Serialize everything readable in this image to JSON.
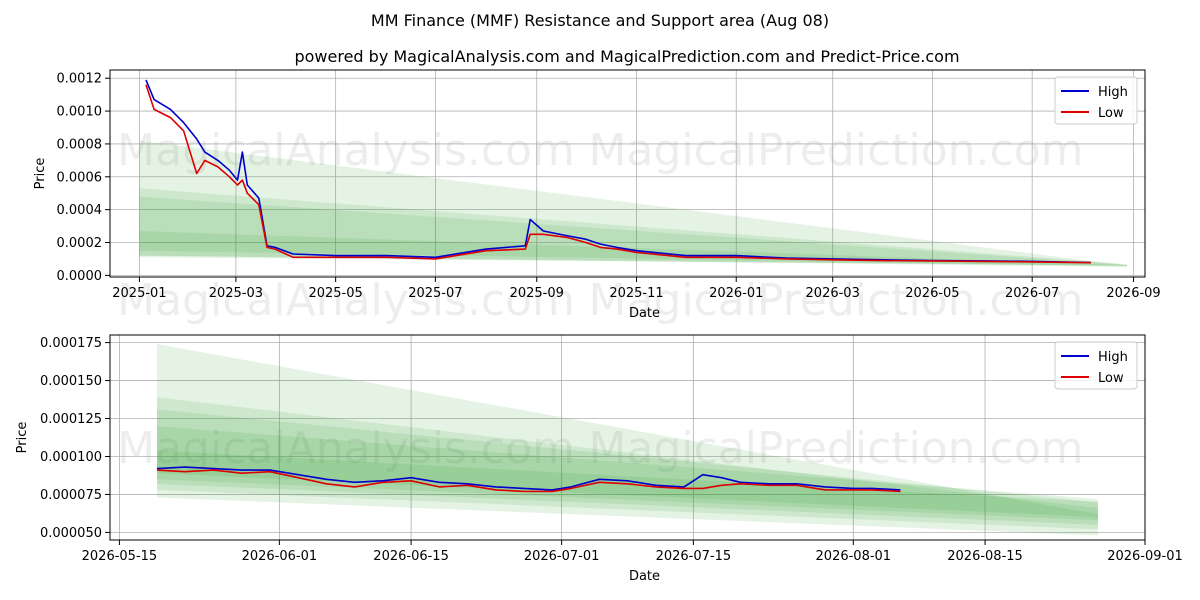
{
  "title": "MM Finance (MMF) Resistance and Support area (Aug 08)",
  "subtitle": "powered by MagicalAnalysis.com and MagicalPrediction.com and Predict-Price.com",
  "watermarks": [
    "MagicalAnalysis.com",
    "MagicalPrediction.com"
  ],
  "colors": {
    "high": "#0000cc",
    "low": "#dd0000",
    "band": "#2ca02c",
    "grid": "#b0b0b0"
  },
  "chart_data": [
    {
      "type": "line",
      "xlabel": "Date",
      "ylabel": "Price",
      "xlim": [
        "2024-12-14",
        "2026-09-08"
      ],
      "ylim": [
        -1e-05,
        0.00125
      ],
      "x_ticks": [
        "2025-01",
        "2025-03",
        "2025-05",
        "2025-07",
        "2025-09",
        "2025-11",
        "2026-01",
        "2026-03",
        "2026-05",
        "2026-07",
        "2026-09"
      ],
      "y_ticks": [
        "0.0000",
        "0.0002",
        "0.0004",
        "0.0006",
        "0.0008",
        "0.0010",
        "0.0012"
      ],
      "legend": {
        "position": "top-right",
        "entries": [
          "High",
          "Low"
        ]
      },
      "grid": true,
      "series": [
        {
          "name": "High",
          "x": [
            "2025-01-05",
            "2025-01-10",
            "2025-01-20",
            "2025-01-28",
            "2025-02-05",
            "2025-02-10",
            "2025-02-18",
            "2025-02-25",
            "2025-03-02",
            "2025-03-05",
            "2025-03-08",
            "2025-03-15",
            "2025-03-20",
            "2025-03-25",
            "2025-04-05",
            "2025-05-01",
            "2025-06-01",
            "2025-07-01",
            "2025-08-01",
            "2025-08-25",
            "2025-08-28",
            "2025-09-05",
            "2025-09-20",
            "2025-10-01",
            "2025-10-10",
            "2025-10-20",
            "2025-11-01",
            "2025-12-01",
            "2026-01-01",
            "2026-02-01",
            "2026-03-01",
            "2026-04-01",
            "2026-05-01",
            "2026-06-01",
            "2026-07-01",
            "2026-08-06"
          ],
          "values": [
            0.00119,
            0.00107,
            0.00101,
            0.00093,
            0.00083,
            0.00075,
            0.0007,
            0.00064,
            0.00058,
            0.00075,
            0.00055,
            0.00047,
            0.00018,
            0.00017,
            0.00013,
            0.00012,
            0.00012,
            0.00011,
            0.00016,
            0.00018,
            0.00034,
            0.00027,
            0.00024,
            0.00022,
            0.00019,
            0.00017,
            0.00015,
            0.00012,
            0.00012,
            0.000105,
            0.0001,
            9.5e-05,
            9e-05,
            8.8e-05,
            8.5e-05,
            7.8e-05
          ]
        },
        {
          "name": "Low",
          "x": [
            "2025-01-05",
            "2025-01-10",
            "2025-01-20",
            "2025-01-28",
            "2025-02-05",
            "2025-02-10",
            "2025-02-18",
            "2025-02-25",
            "2025-03-02",
            "2025-03-05",
            "2025-03-08",
            "2025-03-15",
            "2025-03-20",
            "2025-03-25",
            "2025-04-05",
            "2025-05-01",
            "2025-06-01",
            "2025-07-01",
            "2025-08-01",
            "2025-08-25",
            "2025-08-28",
            "2025-09-05",
            "2025-09-20",
            "2025-10-01",
            "2025-10-10",
            "2025-10-20",
            "2025-11-01",
            "2025-12-01",
            "2026-01-01",
            "2026-02-01",
            "2026-03-01",
            "2026-04-01",
            "2026-05-01",
            "2026-06-01",
            "2026-07-01",
            "2026-08-06"
          ],
          "values": [
            0.00116,
            0.00101,
            0.00096,
            0.00088,
            0.00062,
            0.0007,
            0.00066,
            0.0006,
            0.00055,
            0.00058,
            0.0005,
            0.00043,
            0.00017,
            0.00016,
            0.00011,
            0.00011,
            0.00011,
            0.0001,
            0.00015,
            0.00016,
            0.00025,
            0.00025,
            0.00023,
            0.0002,
            0.00017,
            0.00016,
            0.00014,
            0.00011,
            0.00011,
            0.0001,
            9.5e-05,
            9e-05,
            8.8e-05,
            8.5e-05,
            8.2e-05,
            7.7e-05
          ]
        }
      ],
      "bands": [
        {
          "x": [
            "2025-01-01",
            "2026-08-28"
          ],
          "upper": [
            0.00082,
            6e-05
          ],
          "lower": [
            0.00011,
            6e-05
          ]
        },
        {
          "x": [
            "2025-01-01",
            "2026-08-28"
          ],
          "upper": [
            0.00053,
            6.8e-05
          ],
          "lower": [
            0.00012,
            5.8e-05
          ]
        },
        {
          "x": [
            "2025-01-01",
            "2026-08-28"
          ],
          "upper": [
            0.00048,
            6.5e-05
          ],
          "lower": [
            0.00015,
            5.5e-05
          ]
        },
        {
          "x": [
            "2025-01-01",
            "2026-08-28"
          ],
          "upper": [
            0.00027,
            6.2e-05
          ],
          "lower": [
            0.00012,
            5.2e-05
          ]
        }
      ]
    },
    {
      "type": "line",
      "xlabel": "Date",
      "ylabel": "Price",
      "xlim": [
        "2026-05-14",
        "2026-09-01"
      ],
      "ylim": [
        4.5e-05,
        0.00018
      ],
      "x_ticks": [
        "2026-05-15",
        "2026-06-01",
        "2026-06-15",
        "2026-07-01",
        "2026-07-15",
        "2026-08-01",
        "2026-08-15",
        "2026-09-01"
      ],
      "y_ticks": [
        "0.000050",
        "0.000075",
        "0.000100",
        "0.000125",
        "0.000150",
        "0.000175"
      ],
      "legend": {
        "position": "top-right",
        "entries": [
          "High",
          "Low"
        ]
      },
      "grid": true,
      "series": [
        {
          "name": "High",
          "x": [
            "2026-05-19",
            "2026-05-22",
            "2026-05-25",
            "2026-05-28",
            "2026-05-31",
            "2026-06-03",
            "2026-06-06",
            "2026-06-09",
            "2026-06-12",
            "2026-06-15",
            "2026-06-18",
            "2026-06-21",
            "2026-06-24",
            "2026-06-27",
            "2026-06-30",
            "2026-07-02",
            "2026-07-05",
            "2026-07-08",
            "2026-07-11",
            "2026-07-14",
            "2026-07-16",
            "2026-07-18",
            "2026-07-20",
            "2026-07-23",
            "2026-07-26",
            "2026-07-29",
            "2026-08-01",
            "2026-08-03",
            "2026-08-06"
          ],
          "values": [
            9.2e-05,
            9.3e-05,
            9.2e-05,
            9.1e-05,
            9.1e-05,
            8.8e-05,
            8.5e-05,
            8.3e-05,
            8.4e-05,
            8.6e-05,
            8.3e-05,
            8.2e-05,
            8e-05,
            7.9e-05,
            7.8e-05,
            8e-05,
            8.5e-05,
            8.4e-05,
            8.1e-05,
            8e-05,
            8.8e-05,
            8.6e-05,
            8.3e-05,
            8.2e-05,
            8.2e-05,
            8e-05,
            7.9e-05,
            7.9e-05,
            7.8e-05
          ]
        },
        {
          "name": "Low",
          "x": [
            "2026-05-19",
            "2026-05-22",
            "2026-05-25",
            "2026-05-28",
            "2026-05-31",
            "2026-06-03",
            "2026-06-06",
            "2026-06-09",
            "2026-06-12",
            "2026-06-15",
            "2026-06-18",
            "2026-06-21",
            "2026-06-24",
            "2026-06-27",
            "2026-06-30",
            "2026-07-02",
            "2026-07-05",
            "2026-07-08",
            "2026-07-11",
            "2026-07-14",
            "2026-07-16",
            "2026-07-18",
            "2026-07-20",
            "2026-07-23",
            "2026-07-26",
            "2026-07-29",
            "2026-08-01",
            "2026-08-03",
            "2026-08-06"
          ],
          "values": [
            9.1e-05,
            9e-05,
            9.1e-05,
            8.9e-05,
            9e-05,
            8.6e-05,
            8.2e-05,
            8e-05,
            8.3e-05,
            8.4e-05,
            8e-05,
            8.1e-05,
            7.8e-05,
            7.7e-05,
            7.7e-05,
            7.9e-05,
            8.3e-05,
            8.2e-05,
            8e-05,
            7.9e-05,
            7.9e-05,
            8.1e-05,
            8.2e-05,
            8.1e-05,
            8.1e-05,
            7.8e-05,
            7.8e-05,
            7.8e-05,
            7.7e-05
          ]
        }
      ],
      "bands": [
        {
          "x": [
            "2026-05-19",
            "2026-08-27"
          ],
          "upper": [
            0.000174,
            6.2e-05
          ],
          "lower": [
            7.3e-05,
            4.8e-05
          ]
        },
        {
          "x": [
            "2026-05-19",
            "2026-08-27"
          ],
          "upper": [
            0.000139,
            6.6e-05
          ],
          "lower": [
            7.8e-05,
            5.2e-05
          ]
        },
        {
          "x": [
            "2026-05-19",
            "2026-08-27"
          ],
          "upper": [
            0.000131,
            7e-05
          ],
          "lower": [
            8.2e-05,
            5.5e-05
          ]
        },
        {
          "x": [
            "2026-05-19",
            "2026-08-27"
          ],
          "upper": [
            0.00012,
            7.2e-05
          ],
          "lower": [
            8.5e-05,
            5.8e-05
          ]
        },
        {
          "x": [
            "2026-05-19",
            "2026-08-27"
          ],
          "upper": [
            0.000104,
            7e-05
          ],
          "lower": [
            8.9e-05,
            6e-05
          ]
        }
      ]
    }
  ]
}
